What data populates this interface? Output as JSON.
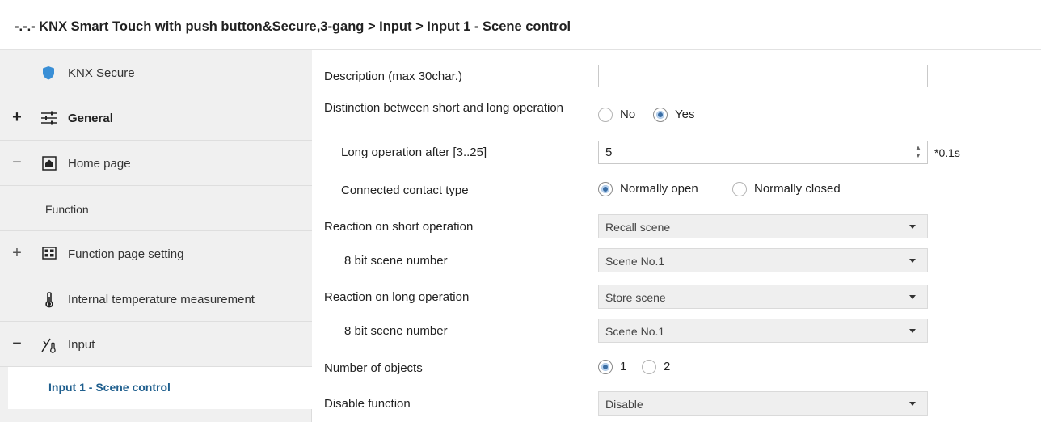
{
  "breadcrumb": "-.-.- KNX Smart Touch with push button&Secure,3-gang > Input > Input 1 - Scene control",
  "sidebar": {
    "items": [
      {
        "label": "KNX Secure",
        "toggle": "",
        "icon": "shield-icon"
      },
      {
        "label": "General",
        "toggle": "+",
        "icon": "sliders-icon"
      },
      {
        "label": "Home page",
        "toggle": "−",
        "icon": "home-icon"
      },
      {
        "label": "Function",
        "toggle": "",
        "icon": ""
      },
      {
        "label": "Function page setting",
        "toggle": "+",
        "icon": "grid-icon"
      },
      {
        "label": "Internal temperature measurement",
        "toggle": "",
        "icon": "thermometer-icon"
      },
      {
        "label": "Input",
        "toggle": "−",
        "icon": "input-icon"
      },
      {
        "label": "Input 1 - Scene control",
        "toggle": "",
        "icon": ""
      }
    ]
  },
  "params": {
    "description": {
      "label": "Description (max 30char.)",
      "value": ""
    },
    "distinction": {
      "label": "Distinction between short and long operation",
      "options": [
        "No",
        "Yes"
      ],
      "selected": "Yes"
    },
    "long_after": {
      "label": "Long operation after [3..25]",
      "value": "5",
      "unit": "*0.1s"
    },
    "contact_type": {
      "label": "Connected contact type",
      "options": [
        "Normally open",
        "Normally closed"
      ],
      "selected": "Normally open"
    },
    "short_reaction": {
      "label": "Reaction on short operation",
      "value": "Recall scene"
    },
    "short_scene": {
      "label": "8 bit scene number",
      "value": "Scene No.1"
    },
    "long_reaction": {
      "label": "Reaction on long operation",
      "value": "Store scene"
    },
    "long_scene": {
      "label": "8 bit scene number",
      "value": "Scene No.1"
    },
    "num_objects": {
      "label": "Number of objects",
      "options": [
        "1",
        "2"
      ],
      "selected": "1"
    },
    "disable_function": {
      "label": "Disable function",
      "value": "Disable"
    }
  },
  "colors": {
    "accent": "#3a6ea5",
    "active_text": "#1f5f8e",
    "sidebar_bg": "#f0f0f0"
  }
}
